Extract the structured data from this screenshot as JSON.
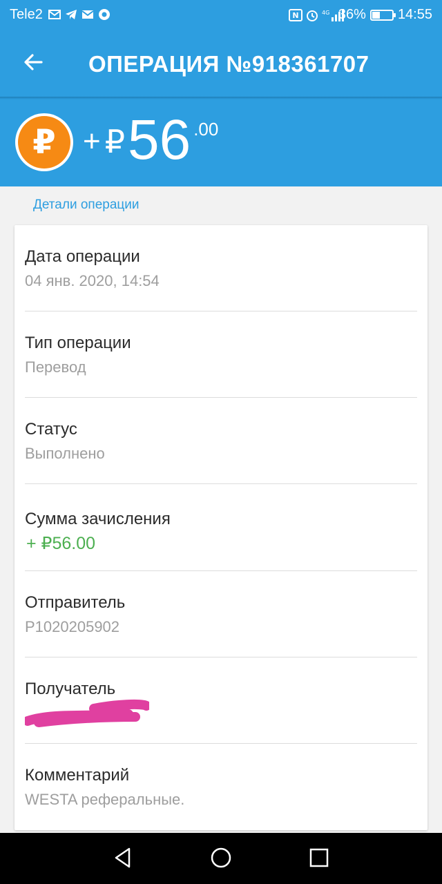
{
  "status_bar": {
    "carrier": "Tele2",
    "battery": "36%",
    "battery_level": 0.36,
    "time": "14:55",
    "left_icons": [
      "mail-icon",
      "telegram-icon",
      "mail-icon",
      "chrome-icon"
    ],
    "right_icons": [
      "nfc-icon",
      "alarm-icon",
      "signal-4g-icon",
      "battery-icon"
    ]
  },
  "app_bar": {
    "title": "ОПЕРАЦИЯ №918361707",
    "back_icon": "arrow-left-icon"
  },
  "amount": {
    "sign": "+",
    "currency": "₽",
    "integer": "56",
    "decimal": ".00",
    "coin_symbol": "₽",
    "coin_color": "#f68a14"
  },
  "section": {
    "title": "Детали операции"
  },
  "details": [
    {
      "label": "Дата операции",
      "value": "04 янв. 2020, 14:54"
    },
    {
      "label": "Тип операции",
      "value": "Перевод"
    },
    {
      "label": "Статус",
      "value": "Выполнено"
    },
    {
      "label": "Сумма зачисления",
      "value": "+ ₽56.00"
    },
    {
      "label": "Отправитель",
      "value": "P1020205902"
    },
    {
      "label": "Получатель",
      "value": ""
    },
    {
      "label": "Комментарий",
      "value": "WESTA реферальные."
    }
  ],
  "colors": {
    "primary": "#2d9ee0",
    "positive": "#4caf50",
    "redaction": "#e040a0"
  },
  "nav_bar": [
    "back-triangle-icon",
    "home-circle-icon",
    "recents-square-icon"
  ]
}
